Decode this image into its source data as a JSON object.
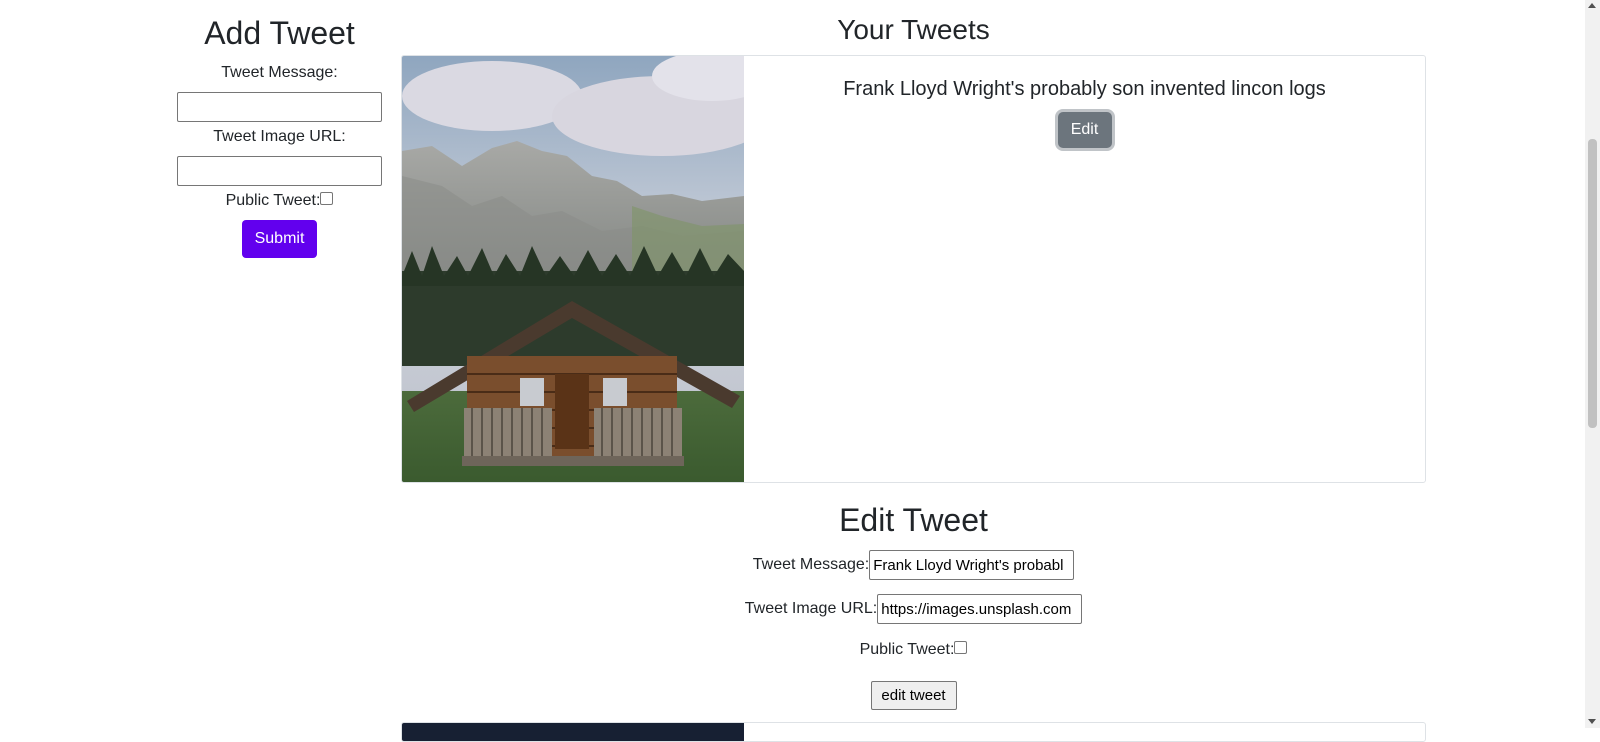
{
  "add_tweet": {
    "title": "Add Tweet",
    "message_label": "Tweet Message:",
    "message_value": "",
    "image_label": "Tweet Image URL:",
    "image_value": "",
    "public_label": "Public Tweet:",
    "public_checked": false,
    "submit_label": "Submit"
  },
  "your_tweets": {
    "title": "Your Tweets",
    "tweets": [
      {
        "image_icon": "log-cabin-mountain-photo",
        "text": "Frank Lloyd Wright's probably son invented lincon logs",
        "edit_label": "Edit"
      }
    ]
  },
  "edit_tweet": {
    "title": "Edit Tweet",
    "message_label": "Tweet Message:",
    "message_value": "Frank Lloyd Wright's probabl",
    "image_label": "Tweet Image URL:",
    "image_value": "https://images.unsplash.com",
    "public_label": "Public Tweet:",
    "public_checked": false,
    "submit_label": "edit tweet"
  },
  "colors": {
    "submit_button": "#6200ee",
    "edit_button": "#6c757d",
    "next_image": "#172033"
  }
}
